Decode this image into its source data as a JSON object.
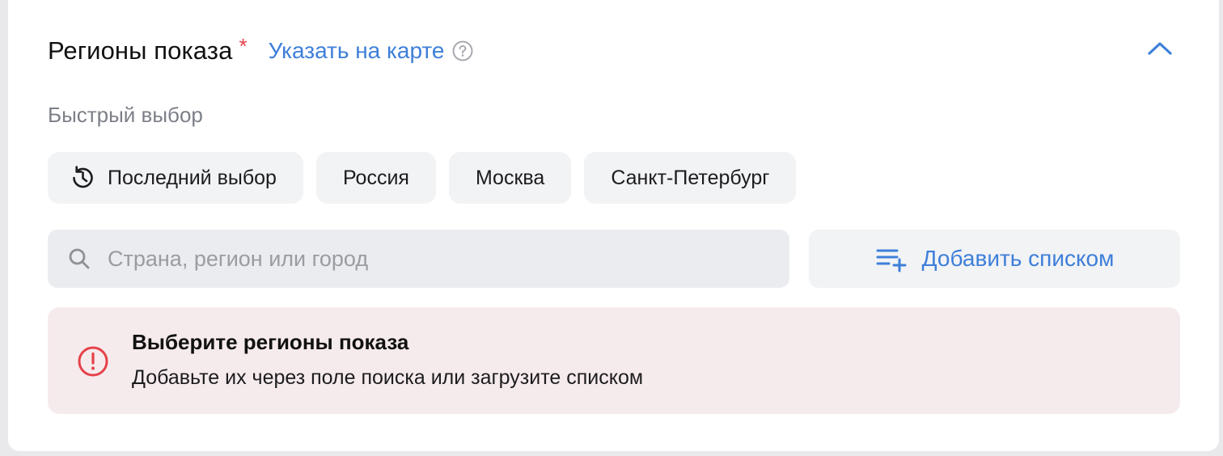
{
  "section": {
    "title": "Регионы показа",
    "required_mark": "*",
    "map_link": "Указать на карте"
  },
  "quick_select": {
    "label": "Быстрый выбор",
    "chips": [
      {
        "label": "Последний выбор",
        "icon": "history-icon"
      },
      {
        "label": "Россия"
      },
      {
        "label": "Москва"
      },
      {
        "label": "Санкт-Петербург"
      }
    ]
  },
  "search": {
    "placeholder": "Страна, регион или город",
    "value": ""
  },
  "add_list": {
    "label": "Добавить списком",
    "icon": "list-add-icon"
  },
  "alert": {
    "title": "Выберите регионы показа",
    "text": "Добавьте их через поле поиска или загрузите списком",
    "icon": "exclamation-circle-icon"
  },
  "colors": {
    "accent": "#3d7fd9",
    "error": "#e6414a",
    "alert_bg": "#f6ebec",
    "chip_bg": "#f2f3f5"
  }
}
